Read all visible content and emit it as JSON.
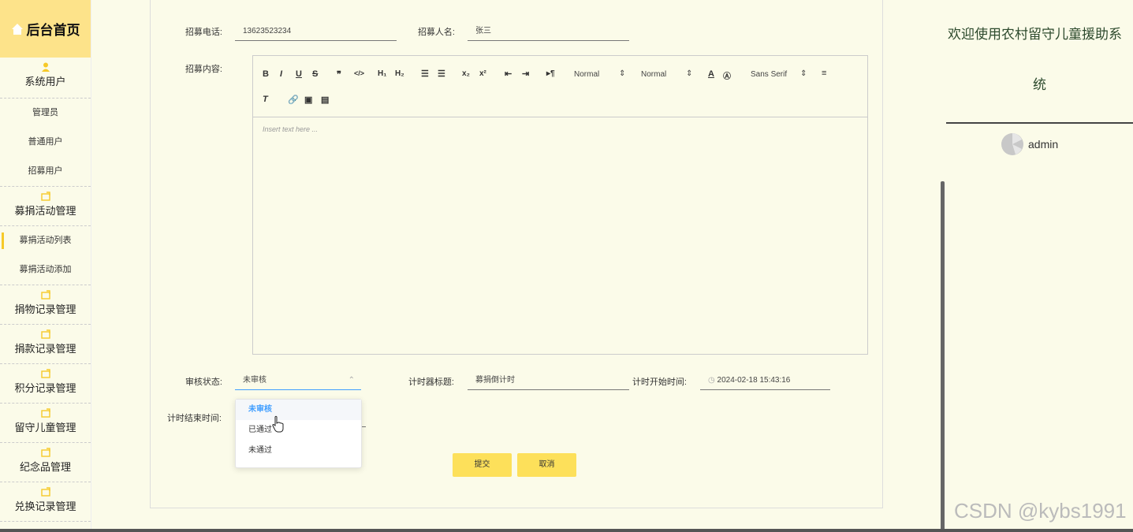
{
  "sidebar": {
    "logo": "后台首页",
    "groups": [
      {
        "label": "系统用户",
        "subs": [
          "管理员",
          "普通用户",
          "招募用户"
        ]
      },
      {
        "label": "募捐活动管理",
        "subs": [
          "募捐活动列表",
          "募捐活动添加"
        ]
      },
      {
        "label": "捐物记录管理"
      },
      {
        "label": "捐款记录管理"
      },
      {
        "label": "积分记录管理"
      },
      {
        "label": "留守儿童管理"
      },
      {
        "label": "纪念品管理"
      },
      {
        "label": "兑换记录管理"
      }
    ]
  },
  "form": {
    "phone_label": "招募电话:",
    "phone_value": "13623523234",
    "name_label": "招募人名:",
    "name_value": "张三",
    "content_label": "招募内容:",
    "editor": {
      "font_size_1": "Normal",
      "font_size_2": "Normal",
      "font_family": "Sans Serif",
      "placeholder": "Insert text here ..."
    },
    "status_label": "审核状态:",
    "status_value": "未审核",
    "timer_title_label": "计时器标题:",
    "timer_title_value": "募捐倒计时",
    "timer_start_label": "计时开始时间:",
    "timer_start_value": "2024-02-18 15:43:16",
    "timer_end_label": "计时结束时间:",
    "dropdown_options": [
      "未审核",
      "已通过",
      "未通过"
    ],
    "submit": "提交",
    "cancel": "取消"
  },
  "right": {
    "welcome_line1": "欢迎使用农村留守儿童援助系",
    "welcome_line2": "统",
    "username": "admin"
  },
  "watermark": "CSDN @kybs1991",
  "colors": {
    "accent": "#fde05a",
    "active_bar": "#f6c928",
    "background": "#fbfbe9",
    "select": "#409eff"
  }
}
